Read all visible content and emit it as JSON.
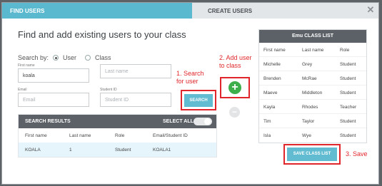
{
  "tabs": {
    "find_users": "FIND USERS",
    "create_users": "CREATE USERS"
  },
  "close_glyph": "✕",
  "heading": "Find and add existing users to your class",
  "search_by": {
    "label": "Search by:",
    "user": "User",
    "class": "Class",
    "selected": "User"
  },
  "fields": {
    "first_name": {
      "label": "First name",
      "value": "koala"
    },
    "last_name": {
      "label": "",
      "placeholder": "Last name"
    },
    "email": {
      "label": "Email",
      "placeholder": "Email"
    },
    "student_id": {
      "label": "Student ID",
      "placeholder": "Student ID"
    }
  },
  "search_button": "SEARCH",
  "annotations": {
    "step1": "1. Search for user",
    "step2": "2. Add user to class",
    "step3": "3. Save"
  },
  "add_glyph": "+",
  "remove_glyph": "−",
  "search_results": {
    "title": "SEARCH RESULTS",
    "select_all": "SELECT ALL",
    "columns": [
      "First name",
      "Last name",
      "Role",
      "Email/Student ID"
    ],
    "rows": [
      [
        "KOALA",
        "1",
        "Student",
        "KOALA1"
      ]
    ]
  },
  "class_list": {
    "title": "Emu CLASS LIST",
    "columns": [
      "First name",
      "Last name",
      "Role"
    ],
    "rows": [
      [
        "Michelle",
        "Grey",
        "Student"
      ],
      [
        "Brenden",
        "McRae",
        "Student"
      ],
      [
        "Maeve",
        "Middleton",
        "Student"
      ],
      [
        "Kayla",
        "Rhodes",
        "Teacher"
      ],
      [
        "Tim",
        "Taylor",
        "Student"
      ],
      [
        "Isla",
        "Wye",
        "Student"
      ]
    ]
  },
  "save_button": "SAVE CLASS LIST",
  "colors": {
    "accent": "#5bb9cf",
    "header_dark": "#5b6167",
    "highlight_red": "#e0262b",
    "add_green": "#3cae4a"
  }
}
